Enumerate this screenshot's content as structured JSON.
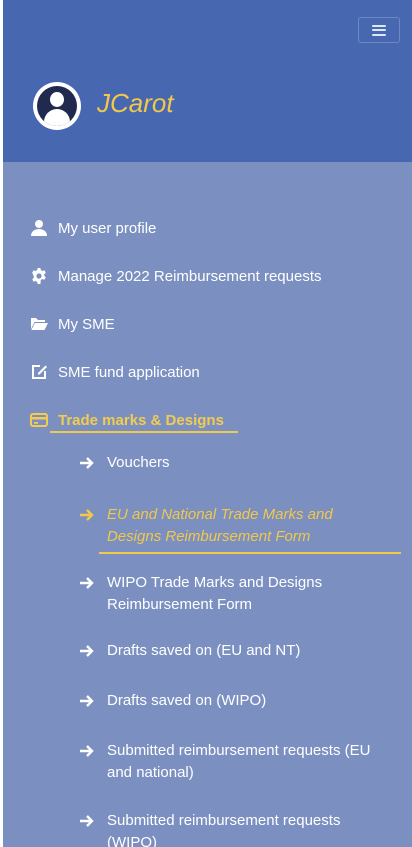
{
  "header": {
    "username": "JCarot",
    "menu_icon": "hamburger-icon",
    "avatar_icon": "user-circle-icon"
  },
  "nav": {
    "items": [
      {
        "label": "My user profile",
        "icon": "user-icon"
      },
      {
        "label": "Manage 2022 Reimbursement requests",
        "icon": "gear-icon"
      },
      {
        "label": "My SME",
        "icon": "folder-open-icon"
      },
      {
        "label": "SME fund application",
        "icon": "edit-icon"
      },
      {
        "label": "Trade marks & Designs",
        "icon": "credit-card-icon",
        "active": true
      }
    ],
    "sub_items": [
      {
        "label": "Vouchers"
      },
      {
        "label": "EU and National Trade Marks and Designs Reimbursement Form",
        "active": true
      },
      {
        "label": "WIPO Trade Marks and Designs Reimbursement Form"
      },
      {
        "label": "Drafts saved on (EU and NT)"
      },
      {
        "label": "Drafts saved on (WIPO)"
      },
      {
        "label": "Submitted reimbursement requests (EU and national)"
      },
      {
        "label": "Submitted reimbursement requests (WIPO)"
      }
    ]
  },
  "colors": {
    "header_bg": "#4867b1",
    "sidebar_bg": "#7b90c1",
    "accent": "#f1c84a",
    "text": "#ffffff"
  }
}
